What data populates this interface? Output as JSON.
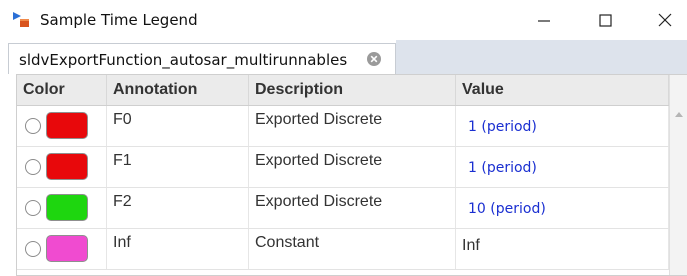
{
  "window": {
    "title": "Sample Time Legend",
    "icon": "simulink-icon",
    "controls": [
      "minimize-icon",
      "maximize-icon",
      "close-icon"
    ]
  },
  "tab": {
    "label": "sldvExportFunction_autosar_multirunnables",
    "close_icon": "close-circle-icon"
  },
  "table": {
    "headers": [
      "Color",
      "Annotation",
      "Description",
      "Value"
    ],
    "rows": [
      {
        "color": "#e8080b",
        "annotation": "F0",
        "description": "Exported Discrete",
        "value": "1 (period)",
        "value_is_link": true
      },
      {
        "color": "#e8080b",
        "annotation": "F1",
        "description": "Exported Discrete",
        "value": "1 (period)",
        "value_is_link": true
      },
      {
        "color": "#1ed60f",
        "annotation": "F2",
        "description": "Exported Discrete",
        "value": "10 (period)",
        "value_is_link": true
      },
      {
        "color": "#f04bd0",
        "annotation": "Inf",
        "description": "Constant",
        "value": "Inf",
        "value_is_link": false
      }
    ]
  },
  "colors": {
    "link": "#1a2fd1",
    "header_bg": "#ebebeb",
    "tabstrip_bg": "#dde3ec"
  }
}
